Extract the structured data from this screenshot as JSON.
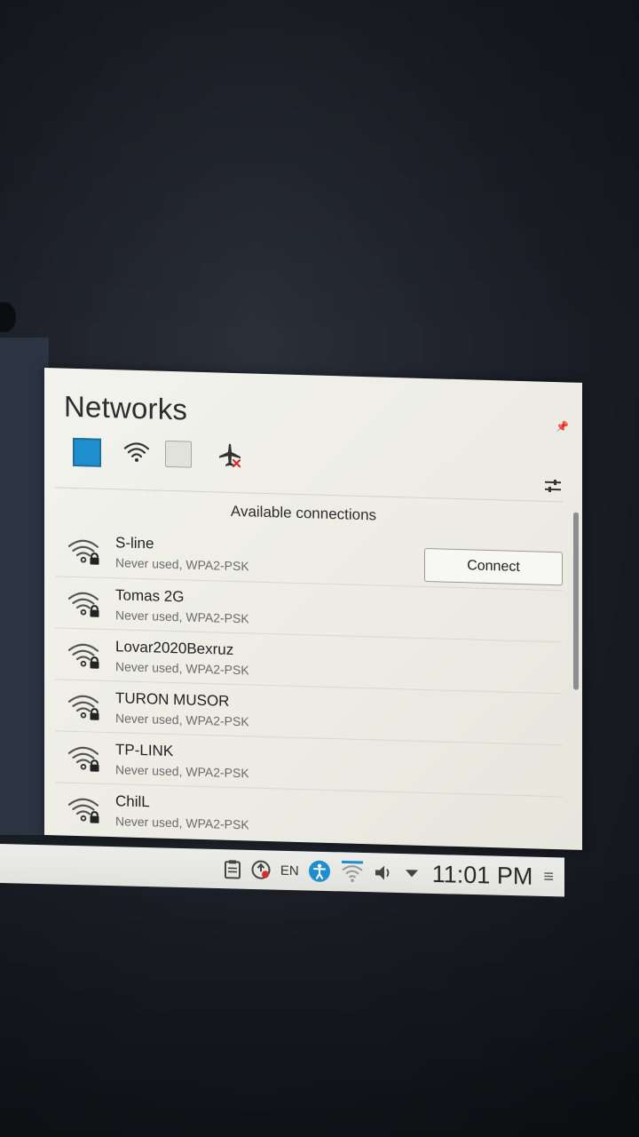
{
  "panel": {
    "title": "Networks"
  },
  "toolbar": {
    "ethernet_icon": "ethernet-toggle-icon",
    "wifi_icon": "wifi-icon",
    "mobile_icon": "mobile-broadband-toggle-icon",
    "airplane_icon": "airplane-mode-icon",
    "settings_icon": "configure-icon"
  },
  "connections": {
    "header": "Available connections",
    "connect_label": "Connect",
    "items": [
      {
        "name": "S-line",
        "detail": "Never used, WPA2-PSK"
      },
      {
        "name": "Tomas 2G",
        "detail": "Never used, WPA2-PSK"
      },
      {
        "name": "Lovar2020Bexruz",
        "detail": "Never used, WPA2-PSK"
      },
      {
        "name": "TURON MUSOR",
        "detail": "Never used, WPA2-PSK"
      },
      {
        "name": "TP-LINK",
        "detail": "Never used, WPA2-PSK"
      },
      {
        "name": "ChilL",
        "detail": "Never used, WPA2-PSK"
      }
    ]
  },
  "taskbar": {
    "language": "EN",
    "clock": "11:01 PM"
  },
  "colors": {
    "accent": "#1f8ecf",
    "panel_bg": "#f0f0ea"
  }
}
